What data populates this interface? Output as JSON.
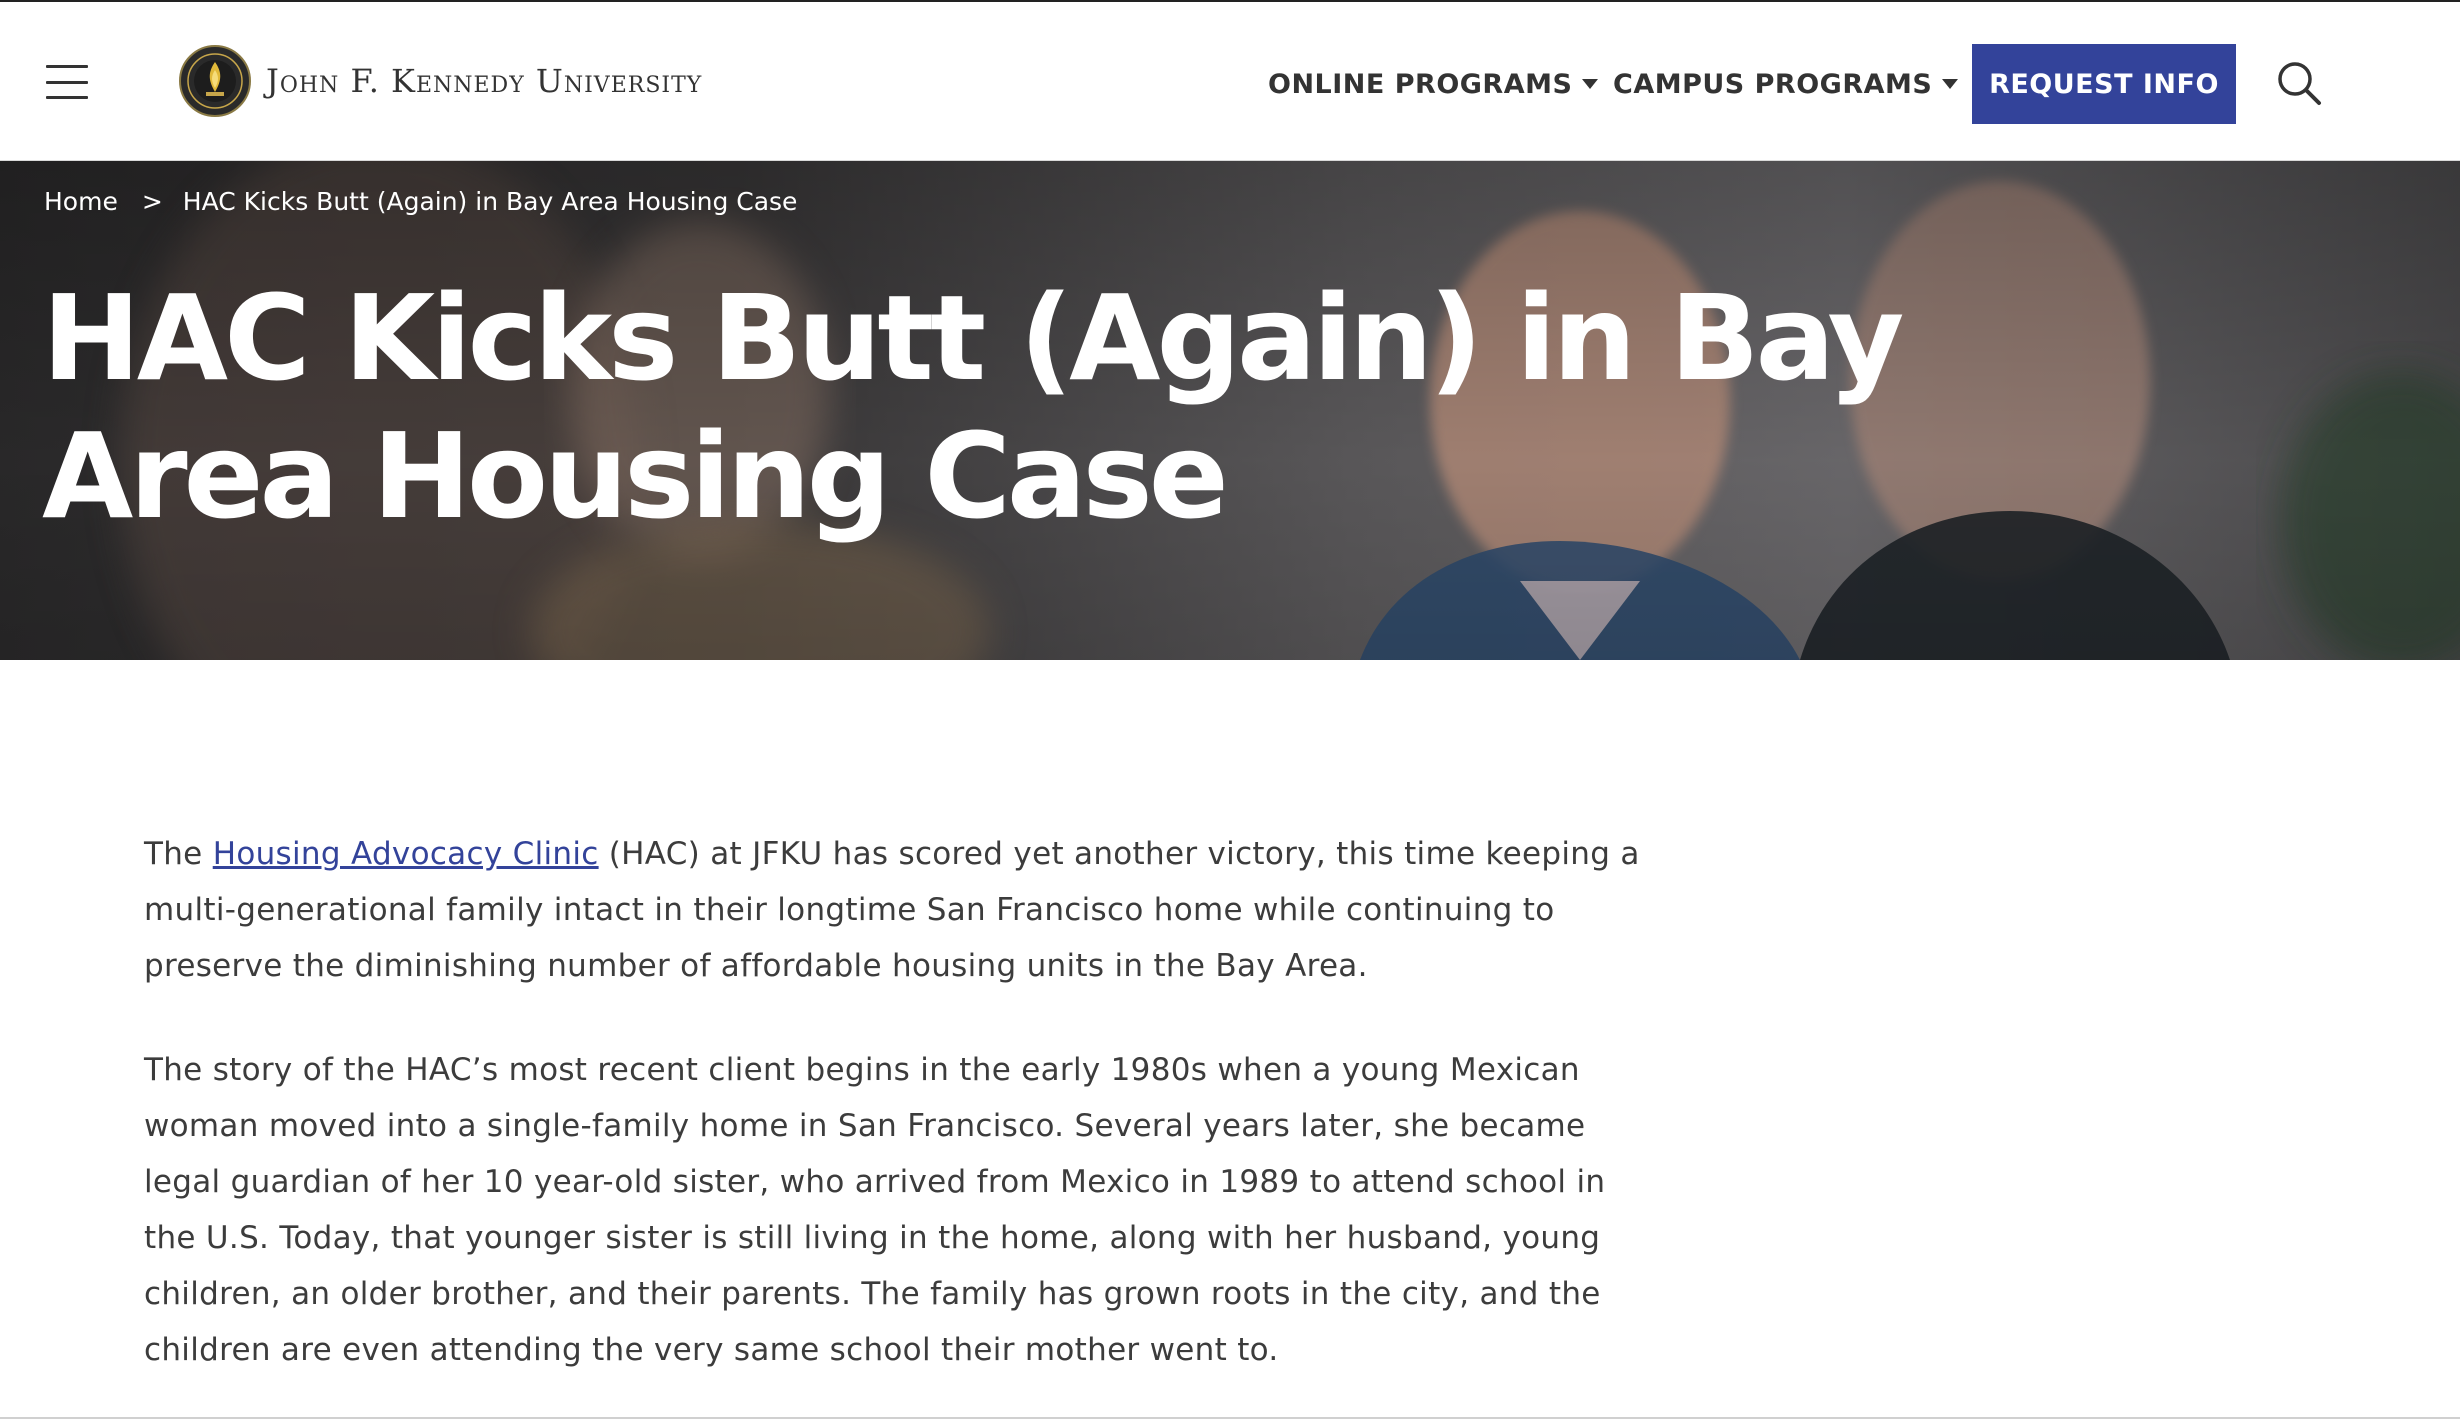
{
  "header": {
    "logo_text": "John F. Kennedy University",
    "nav": [
      {
        "label": "ONLINE PROGRAMS"
      },
      {
        "label": "CAMPUS PROGRAMS"
      }
    ],
    "cta_label": "REQUEST INFO",
    "icons": {
      "menu": "hamburger-menu-icon",
      "search": "search-icon",
      "logo": "university-seal"
    }
  },
  "hero": {
    "breadcrumb": {
      "home": "Home",
      "separator": ">",
      "current": "HAC Kicks Butt (Again) in Bay Area Housing Case"
    },
    "title": "HAC Kicks Butt (Again) in Bay Area Housing Case"
  },
  "article": {
    "p1": {
      "before_link": "The ",
      "link_text": "Housing Advocacy Clinic",
      "after_link": " (HAC) at JFKU has scored yet another victory, this time keeping a multi-generational family intact in their longtime San Francisco home while continuing to preserve the diminishing number of affordable housing units in the Bay Area."
    },
    "p2": "The story of the HAC’s most recent client begins in the early 1980s when a young Mexican woman moved into a single-family home in San Francisco. Several years later, she became legal guardian of her 10 year-old sister, who arrived from Mexico in 1989 to attend school in the U.S. Today, that younger sister is still living in the home, along with her husband, young children, an older brother, and their parents. The family has grown roots in the city, and the children are even attending the very same school their mother went to."
  },
  "colors": {
    "brand_blue": "#33439a",
    "text": "#333333",
    "hero_overlay": "#3a3839"
  }
}
